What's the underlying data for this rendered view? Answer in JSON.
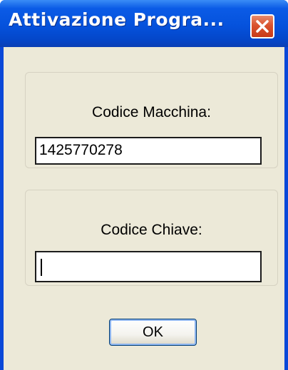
{
  "window": {
    "title": "Attivazione Progra...",
    "close_icon": "close-x-icon"
  },
  "machine_code": {
    "label": "Codice Macchina:",
    "value": "1425770278"
  },
  "key_code": {
    "label": "Codice Chiave:",
    "value": ""
  },
  "ok_button": {
    "label": "OK"
  },
  "colors": {
    "titlebar": "#0552dc",
    "client_background": "#ece9d8",
    "close_button": "#d9532f"
  }
}
